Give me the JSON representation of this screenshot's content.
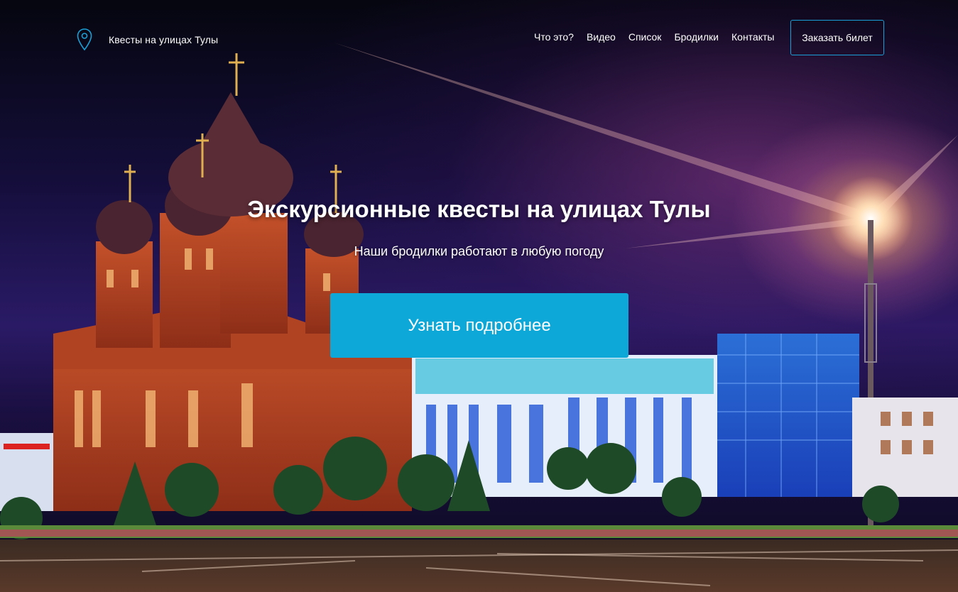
{
  "brand": {
    "icon": "map-pin-icon",
    "title": "Квесты на улицах Тулы"
  },
  "nav": {
    "items": [
      {
        "label": "Что это?"
      },
      {
        "label": "Видео"
      },
      {
        "label": "Список"
      },
      {
        "label": "Бродилки"
      },
      {
        "label": "Контакты"
      }
    ],
    "cta_label": "Заказать билет"
  },
  "hero": {
    "title": "Экскурсионные квесты на улицах Тулы",
    "subtitle": "Наши бродилки работают в любую погоду",
    "button_label": "Узнать подробнее"
  },
  "colors": {
    "accent": "#0da8d8",
    "cta_border": "#1aa0d6",
    "text": "#ffffff"
  }
}
